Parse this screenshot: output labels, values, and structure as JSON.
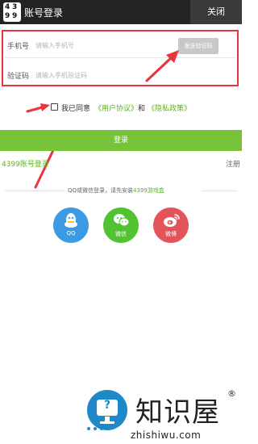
{
  "header": {
    "logo_digits": [
      "4",
      "3",
      "9",
      "9"
    ],
    "title": "账号登录",
    "close_label": "关闭"
  },
  "form": {
    "phone_label": "手机号",
    "phone_placeholder": "请输入手机号",
    "get_code_label": "发送验证码",
    "code_label": "验证码",
    "code_placeholder": "请输入手机验证码"
  },
  "agreement": {
    "text": "我已同意",
    "user_agreement": "《用户协议》",
    "and": "和",
    "privacy_policy": "《隐私政策》"
  },
  "login_button": "登录",
  "links": {
    "account_login": "4399账号登录",
    "register": "注册"
  },
  "third_party": {
    "prefix": "QQ或微信登录，请先安装",
    "app": "4399游戏盒",
    "items": [
      {
        "label": "QQ",
        "icon": "qq-icon",
        "color": "#3b9ae1"
      },
      {
        "label": "微信",
        "icon": "wechat-icon",
        "color": "#51c332"
      },
      {
        "label": "微博",
        "icon": "weibo-icon",
        "color": "#e2535a"
      }
    ]
  },
  "watermark": {
    "title": "知识屋",
    "registered": "®",
    "url": "zhishiwu.com"
  },
  "colors": {
    "header_bg": "#232323",
    "accent_green": "#77c43b",
    "link_green": "#5db31e",
    "annotation_red": "#e8343a"
  }
}
